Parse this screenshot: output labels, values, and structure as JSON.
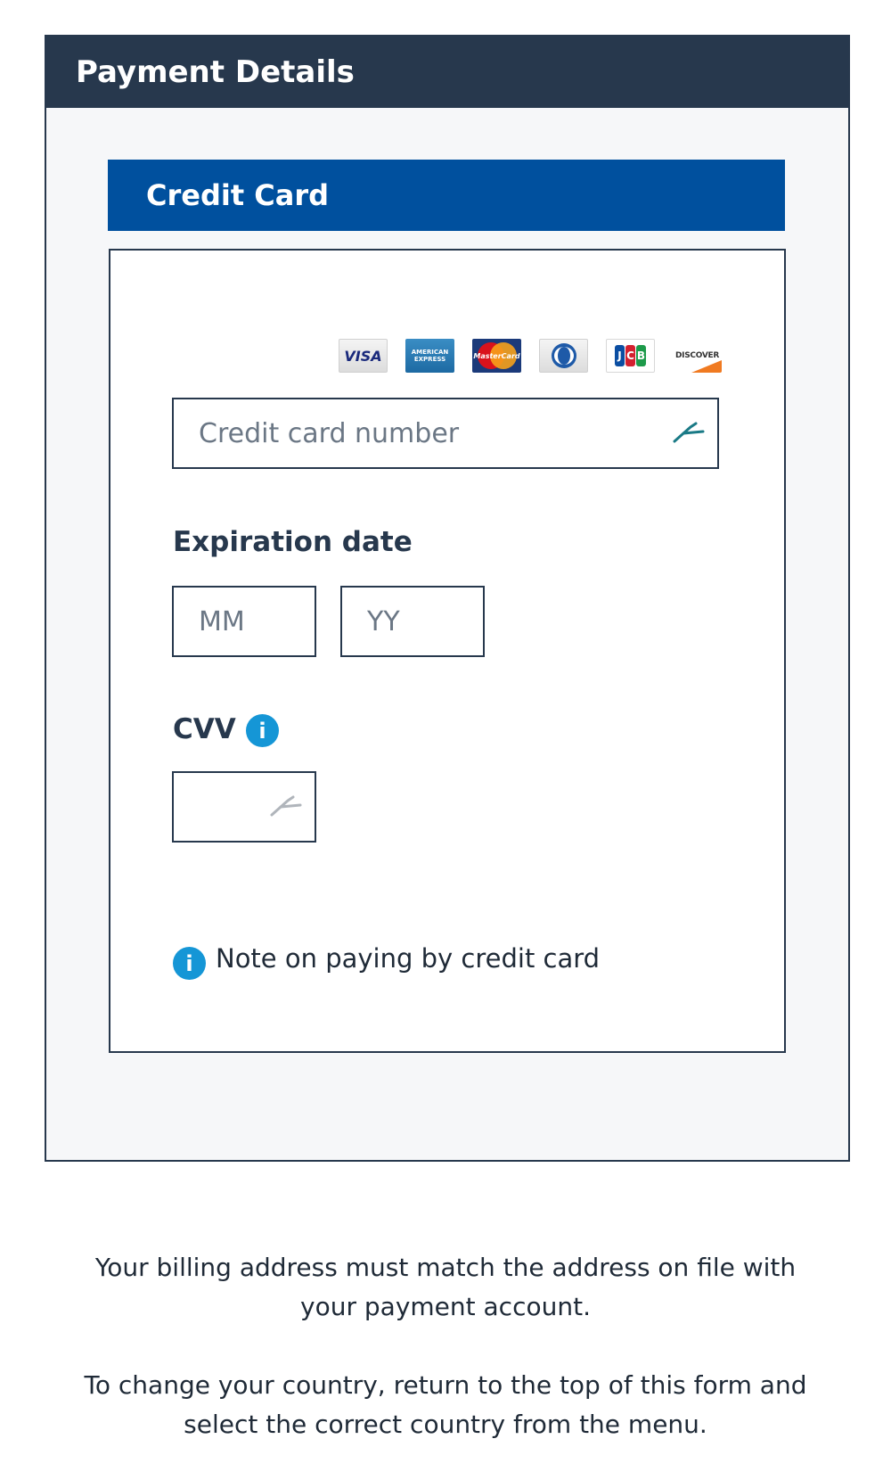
{
  "panel": {
    "title": "Payment Details"
  },
  "credit_card": {
    "title": "Credit Card",
    "card_logos": [
      {
        "name": "VISA",
        "icon": "visa-logo"
      },
      {
        "name": "AMERICAN EXPRESS",
        "icon": "amex-logo"
      },
      {
        "name": "MasterCard",
        "icon": "mastercard-logo"
      },
      {
        "name": "Diners Club",
        "icon": "diners-logo"
      },
      {
        "name": "JCB",
        "icon": "jcb-logo"
      },
      {
        "name": "DISCOVER",
        "icon": "discover-logo"
      }
    ],
    "number_placeholder": "Credit card number",
    "expiration_label": "Expiration date",
    "month_placeholder": "MM",
    "year_placeholder": "YY",
    "cvv_label": "CVV",
    "cvv_value": "",
    "info_glyph": "i",
    "note": "Note on paying by credit card"
  },
  "footer": {
    "billing_notice": "Your billing address must match the address on file with your payment account.",
    "country_notice": "To change your country, return to the top of this form and select the correct country from the menu."
  },
  "colors": {
    "header_bg": "#27384d",
    "card_header_bg": "#00509e",
    "info_icon": "#1596d6",
    "panel_bg": "#f6f7f9"
  }
}
